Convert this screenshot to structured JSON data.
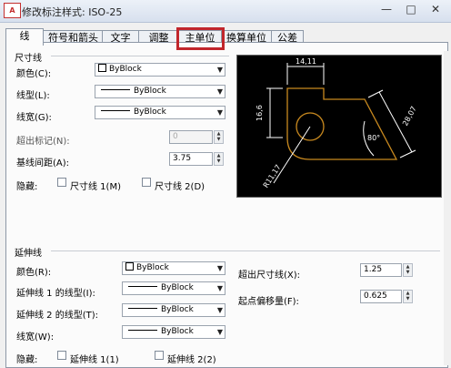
{
  "window": {
    "title": "修改标注样式: ISO-25",
    "app_icon_text": "A",
    "controls": {
      "minimize": "—",
      "maximize": "□",
      "close": "✕"
    }
  },
  "tabs": [
    {
      "label": "线",
      "active": true
    },
    {
      "label": "符号和箭头"
    },
    {
      "label": "文字"
    },
    {
      "label": "调整"
    },
    {
      "label": "主单位",
      "highlighted": true
    },
    {
      "label": "换算单位"
    },
    {
      "label": "公差"
    }
  ],
  "dim_lines": {
    "group_title": "尺寸线",
    "color_label": "颜色(C):",
    "color_value": "ByBlock",
    "linetype_label": "线型(L):",
    "linetype_value": "ByBlock",
    "lineweight_label": "线宽(G):",
    "lineweight_value": "ByBlock",
    "extend_ticks_label": "超出标记(N):",
    "extend_ticks_value": "0",
    "baseline_spacing_label": "基线间距(A):",
    "baseline_spacing_value": "3.75",
    "suppress_label": "隐藏:",
    "suppress_1_label": "尺寸线 1(M)",
    "suppress_2_label": "尺寸线 2(D)"
  },
  "preview": {
    "dim_top": "14,11",
    "dim_left": "16,6",
    "dim_diag": "28,07",
    "dim_angle": "80°",
    "dim_radius": "R11,17",
    "line_color": "#c8891f",
    "dim_color": "#ffffff"
  },
  "ext_lines": {
    "group_title": "延伸线",
    "color_label": "颜色(R):",
    "color_value": "ByBlock",
    "linetype1_label": "延伸线 1 的线型(I):",
    "linetype1_value": "ByBlock",
    "linetype2_label": "延伸线 2 的线型(T):",
    "linetype2_value": "ByBlock",
    "lineweight_label": "线宽(W):",
    "lineweight_value": "ByBlock",
    "suppress_label": "隐藏:",
    "suppress_1_label": "延伸线 1(1)",
    "suppress_2_label": "延伸线 2(2)",
    "extend_beyond_label": "超出尺寸线(X):",
    "extend_beyond_value": "1.25",
    "offset_label": "起点偏移量(F):",
    "offset_value": "0.625"
  },
  "colors": {
    "highlight": "#c1262c",
    "tab_border": "#8d98a7"
  }
}
